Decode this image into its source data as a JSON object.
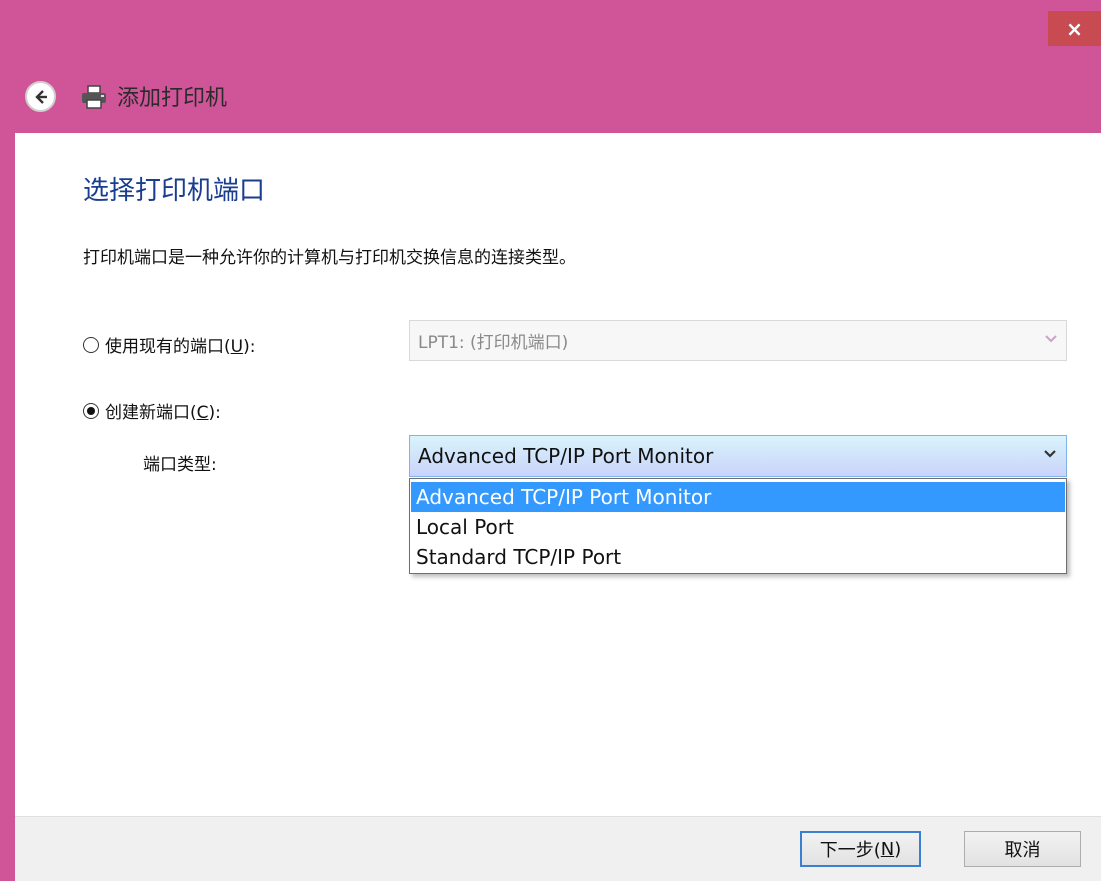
{
  "window": {
    "title": "添加打印机",
    "close_glyph": "×",
    "accent": "#cf5598",
    "close_color": "#c74b50"
  },
  "page": {
    "heading": "选择打印机端口",
    "description": "打印机端口是一种允许你的计算机与打印机交换信息的连接类型。"
  },
  "existing_port": {
    "label_prefix": "使用现有的端口(",
    "label_key": "U",
    "label_suffix": "):",
    "selected": false,
    "value": "LPT1: (打印机端口)"
  },
  "new_port": {
    "label_prefix": "创建新端口(",
    "label_key": "C",
    "label_suffix": "):",
    "selected": true,
    "type_label": "端口类型:",
    "value": "Advanced TCP/IP Port Monitor",
    "options": [
      "Advanced TCP/IP Port Monitor",
      "Local Port",
      "Standard TCP/IP Port"
    ]
  },
  "footer": {
    "next_prefix": "下一步(",
    "next_key": "N",
    "next_suffix": ")",
    "cancel": "取消"
  },
  "icons": {
    "back": "back-arrow-icon",
    "printer": "printer-icon",
    "dropdown": "chevron-down-icon"
  }
}
